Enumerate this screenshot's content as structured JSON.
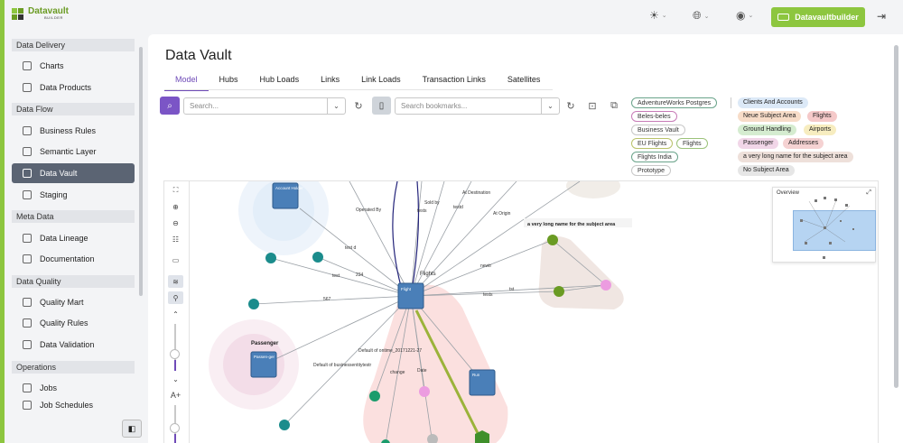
{
  "app": {
    "logo_text": "Datavault",
    "logo_sub": "BUILDER",
    "user_button": "Datavaultbuilder",
    "accent_color": "#8dc63f",
    "active_color": "#5b6473",
    "tab_accent": "#6f4bb8"
  },
  "topbar": {
    "icons": [
      "sun-icon",
      "globe-icon",
      "user-circle-icon"
    ],
    "logout_icon": "logout-icon"
  },
  "sidebar": {
    "sections": [
      {
        "label": "Data Delivery",
        "items": [
          {
            "label": "Charts",
            "icon": "chart-icon"
          },
          {
            "label": "Data Products",
            "icon": "box-icon"
          }
        ]
      },
      {
        "label": "Data Flow",
        "items": [
          {
            "label": "Business Rules",
            "icon": "rules-icon"
          },
          {
            "label": "Semantic Layer",
            "icon": "layer-icon"
          },
          {
            "label": "Data Vault",
            "icon": "network-icon",
            "active": true
          },
          {
            "label": "Staging",
            "icon": "staging-icon"
          }
        ]
      },
      {
        "label": "Meta Data",
        "items": [
          {
            "label": "Data Lineage",
            "icon": "lineage-icon"
          },
          {
            "label": "Documentation",
            "icon": "book-icon"
          }
        ]
      },
      {
        "label": "Data Quality",
        "items": [
          {
            "label": "Quality Mart",
            "icon": "mart-icon"
          },
          {
            "label": "Quality Rules",
            "icon": "rules-icon"
          },
          {
            "label": "Data Validation",
            "icon": "validation-icon"
          }
        ]
      },
      {
        "label": "Operations",
        "items": [
          {
            "label": "Jobs",
            "icon": "jobs-icon"
          },
          {
            "label": "Job Schedules",
            "icon": "schedule-icon"
          }
        ]
      }
    ]
  },
  "main": {
    "title": "Data Vault",
    "tabs": [
      "Model",
      "Hubs",
      "Hub Loads",
      "Links",
      "Link Loads",
      "Transaction Links",
      "Satellites"
    ],
    "active_tab": "Model",
    "search_placeholder": "Search...",
    "bookmark_placeholder": "Search bookmarks...",
    "source_chips": [
      {
        "label": "AdventureWorks Postgres",
        "border": "#6aa38a"
      },
      {
        "label": "Beles-beles",
        "border": "#c77bb7"
      },
      {
        "label": "Business Vault",
        "border": "#c8c8c8"
      },
      {
        "label": "EU Flights",
        "border": "#b9c26a"
      },
      {
        "label": "Flights",
        "border": "#9cc27a"
      },
      {
        "label": "Flights India",
        "border": "#6aa38a"
      },
      {
        "label": "Prototype",
        "border": "#c8c8c8"
      }
    ],
    "subject_tags": [
      {
        "label": "Clients And Accounts",
        "bg": "#dce9f7"
      },
      {
        "label": "Neue Subject Area",
        "bg": "#f7dcc8"
      },
      {
        "label": "Flights",
        "bg": "#f5c9c9"
      },
      {
        "label": "Ground Handling",
        "bg": "#d5ecd0"
      },
      {
        "label": "Airports",
        "bg": "#f7edc0"
      },
      {
        "label": "Passenger",
        "bg": "#f1d6e8"
      },
      {
        "label": "Addresses",
        "bg": "#f5d2d2"
      },
      {
        "label": "a very long name for the subject area",
        "bg": "#eee0da"
      },
      {
        "label": "No Subject Area",
        "bg": "#e6e6e6"
      }
    ]
  },
  "graph": {
    "overview_title": "Overview",
    "tools": [
      "fit-icon",
      "zoom-in-icon",
      "zoom-out-icon",
      "layout-icon",
      "panel-icon",
      "layers-icon",
      "link-icon",
      "expand-icon",
      "collapse-icon"
    ],
    "font_label": "A+",
    "nodes": {
      "hub_flight": "Flight",
      "hub_passenger": "Passen-ger",
      "hub_account": "Account Holder",
      "hub_run": "Run",
      "group_passenger": "Passenger",
      "group_flights": "Flights",
      "group_long": "a very long name for the subject area"
    },
    "edge_labels": [
      "Operated By",
      "Sold by",
      "tests",
      "At Destination",
      "testd",
      "At Origin",
      "test d",
      "test",
      "234",
      "567",
      "newtr",
      "tests",
      "tst",
      "Default of ontime_20171221-27",
      "Default of businessentitytestr",
      "change",
      "Date"
    ]
  }
}
